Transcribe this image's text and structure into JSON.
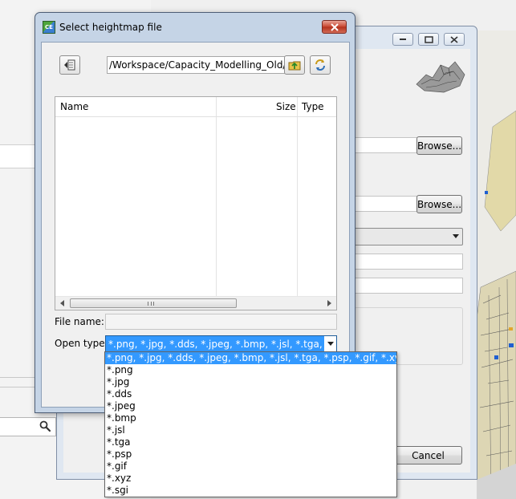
{
  "dialog": {
    "app_icon_text": "CE",
    "title": "Select heightmap file",
    "path": "/Workspace/Capacity_Modelling_Old/map",
    "list_headers": {
      "name": "Name",
      "size": "Size",
      "type": "Type"
    },
    "file_name_label": "File name:",
    "file_name_value": "",
    "open_type_label": "Open type:",
    "open_type_value": "*.png, *.jpg, *.dds, *.jpeg, *.bmp, *.jsl, *.tga, *.psp, *.gif, *.xyz, *.sgi"
  },
  "dropdown": {
    "options": [
      "*.png, *.jpg, *.dds, *.jpeg, *.bmp, *.jsl, *.tga, *.psp, *.gif, *.xyz, *.sgi",
      "*.png",
      "*.jpg",
      "*.dds",
      "*.jpeg",
      "*.bmp",
      "*.jsl",
      "*.tga",
      "*.psp",
      "*.gif",
      "*.xyz",
      "*.sgi"
    ],
    "selected_index": 0
  },
  "parent_window": {
    "browse_label_1": "Browse...",
    "browse_label_2": "Browse...",
    "cancel_label": "Cancel"
  },
  "colors": {
    "selection": "#3399ff",
    "title_bar": "#c5d4e6",
    "close_button": "#c8452f"
  },
  "icons": {
    "back": "back-arrow-icon",
    "up": "folder-up-icon",
    "refresh": "refresh-icon",
    "search": "magnifier-icon",
    "terrain": "terrain-preview-icon"
  }
}
